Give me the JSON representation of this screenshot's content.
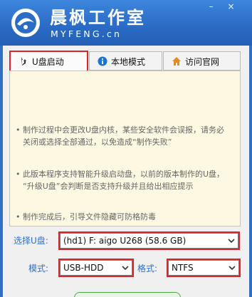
{
  "header": {
    "brand_cn": "晨枫工作室",
    "brand_en": "MYFENG.cn",
    "minimize": "–",
    "close": "×"
  },
  "tabs": [
    {
      "label": "U盘启动",
      "icon": "usb-icon",
      "active": true
    },
    {
      "label": "本地模式",
      "icon": "info-icon",
      "active": false
    },
    {
      "label": "访问官网",
      "icon": "home-icon",
      "active": false
    }
  ],
  "notes": [
    {
      "bullet": "•",
      "lines": [
        "制作过程中会更改U盘内核，某些安全软件会误报，请务必",
        "关闭或选择全部通过，以免造成“制作失败”"
      ]
    },
    {
      "bullet": "•",
      "lines": [
        "此版本程序支持智能升级启动盘，以前的版本制作的U盘，",
        "“升级U盘”会判断是否支持升级并且给出相应提示"
      ]
    },
    {
      "bullet": "•",
      "lines": [
        "制作完成后，引导文件隐藏可防格防毒"
      ]
    }
  ],
  "form": {
    "usb_label": "选择U盘:",
    "usb_value": "(hd1) F: aigo U268 (58.6 GB)",
    "mode_label": "模式:",
    "mode_value": "USB-HDD",
    "format_label": "格式:",
    "format_value": "NTFS"
  },
  "colors": {
    "header_blue": "#2b6cc6",
    "highlight_red": "#d9262a",
    "note_bg": "#fdf8e1",
    "label_blue": "#2f6fd0"
  }
}
